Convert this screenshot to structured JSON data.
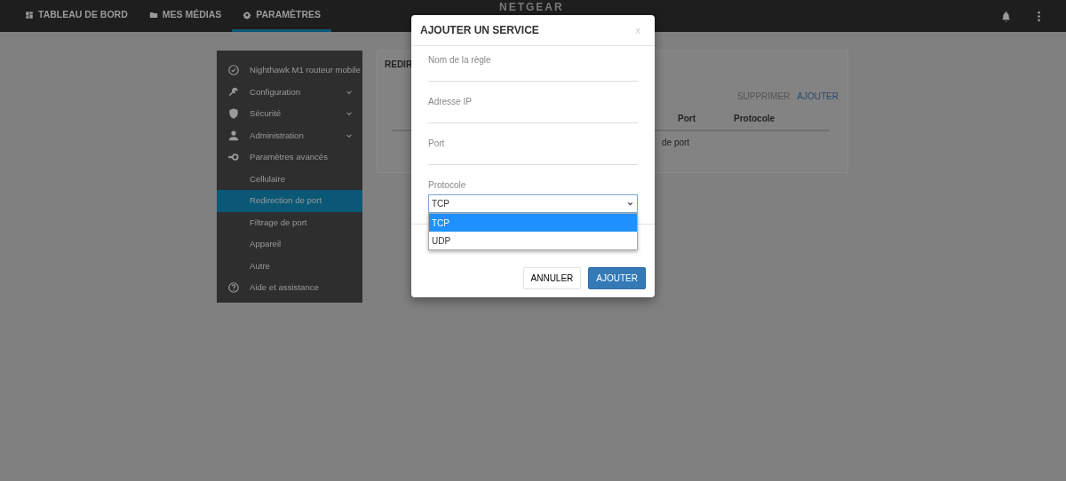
{
  "navbar": {
    "tabs": [
      {
        "label": "TABLEAU DE BORD",
        "selected": false
      },
      {
        "label": "MES MÉDIAS",
        "selected": false
      },
      {
        "label": "PARAMÈTRES",
        "selected": true
      }
    ],
    "logo": "NETGEAR"
  },
  "sidebar": {
    "items": [
      {
        "label": "Nighthawk M1 routeur mobile",
        "selected": false
      },
      {
        "label": "Configuration",
        "selected": false,
        "expanded": false
      },
      {
        "label": "Sécurité",
        "selected": false,
        "expanded": false
      },
      {
        "label": "Administration",
        "selected": false,
        "expanded": false
      },
      {
        "label": "Paramètres avancés",
        "selected": false,
        "expanded": true,
        "children": [
          {
            "label": "Cellulaire",
            "selected": false
          },
          {
            "label": "Redirection de port",
            "selected": true
          },
          {
            "label": "Filtrage de port",
            "selected": false
          },
          {
            "label": "Appareil",
            "selected": false
          },
          {
            "label": "Autre",
            "selected": false
          }
        ]
      },
      {
        "label": "Aide et assistance",
        "selected": false
      }
    ]
  },
  "card": {
    "title": "REDIR",
    "actions": [
      "SUPPRIMER",
      "AJOUTER"
    ],
    "columns": [
      "Port",
      "Protocole"
    ],
    "row_text": "de port"
  },
  "modal": {
    "title": "AJOUTER UN SERVICE",
    "close": "x",
    "fields": [
      {
        "label": "Nom de la règle"
      },
      {
        "label": "Adresse IP"
      },
      {
        "label": "Port"
      }
    ],
    "select": {
      "label": "Protocole",
      "value": "TCP",
      "expanded": true,
      "options": [
        {
          "label": "TCP",
          "selected": true
        },
        {
          "label": "UDP",
          "selected": false
        }
      ]
    },
    "buttons": [
      "ANNULER",
      "AJOUTER"
    ]
  }
}
